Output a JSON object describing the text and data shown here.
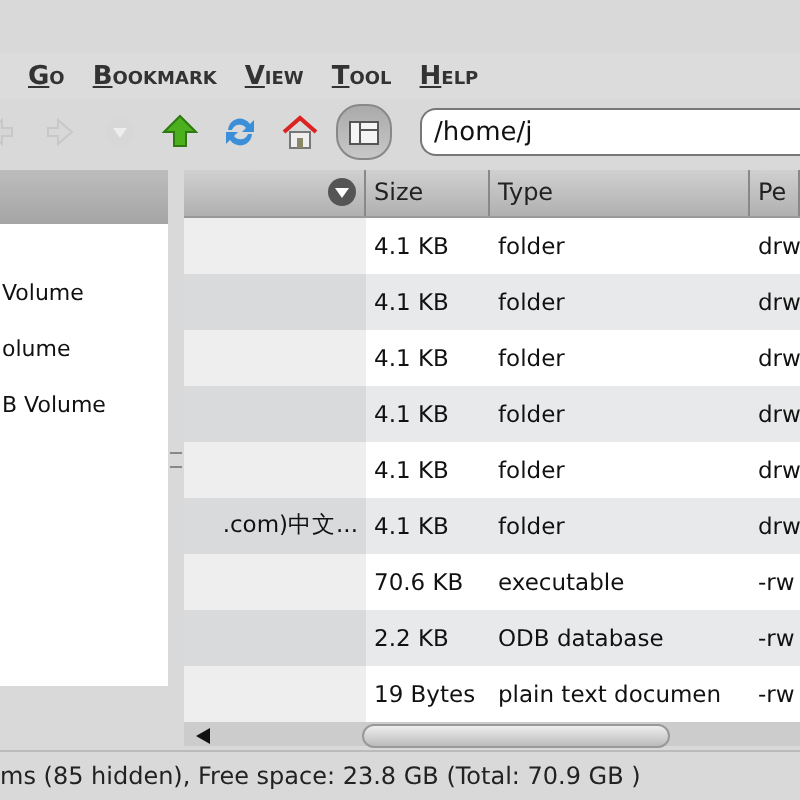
{
  "menu": [
    {
      "label": "Go"
    },
    {
      "label": "Bookmark"
    },
    {
      "label": "View"
    },
    {
      "label": "Tool"
    },
    {
      "label": "Help"
    }
  ],
  "toolbar": [
    {
      "kind": "back",
      "disabled": true
    },
    {
      "kind": "forward",
      "disabled": true
    },
    {
      "kind": "history",
      "disabled": true
    },
    {
      "kind": "up",
      "disabled": false
    },
    {
      "kind": "reload",
      "disabled": false
    },
    {
      "kind": "home",
      "disabled": false
    },
    {
      "kind": "pane",
      "disabled": false,
      "selected": true
    }
  ],
  "location": {
    "value": "/home/j"
  },
  "sidebar": {
    "items": [
      {
        "label": "Volume"
      },
      {
        "label": "olume"
      },
      {
        "label": "B Volume"
      }
    ]
  },
  "table": {
    "columns": [
      {
        "kind": "sort"
      },
      {
        "label": "Size"
      },
      {
        "label": "Type"
      },
      {
        "label": "Pe"
      }
    ],
    "rows": [
      {
        "size": "4.1 KB",
        "type": "folder",
        "perm": "drw"
      },
      {
        "size": "4.1 KB",
        "type": "folder",
        "perm": "drw"
      },
      {
        "size": "4.1 KB",
        "type": "folder",
        "perm": "drw"
      },
      {
        "size": "4.1 KB",
        "type": "folder",
        "perm": "drw"
      },
      {
        "size": "4.1 KB",
        "type": "folder",
        "perm": "drw"
      },
      {
        "name": ".com)中文...",
        "size": "4.1 KB",
        "type": "folder",
        "perm": "drw"
      },
      {
        "size": "70.6 KB",
        "type": "executable",
        "perm": "-rw"
      },
      {
        "size": "2.2 KB",
        "type": "ODB database",
        "perm": "-rw"
      },
      {
        "size": "19 Bytes",
        "type": "plain text documen",
        "perm": "-rw"
      }
    ]
  },
  "status_bar": "ms (85 hidden), Free space: 23.8 GB (Total: 70.9 GB )"
}
